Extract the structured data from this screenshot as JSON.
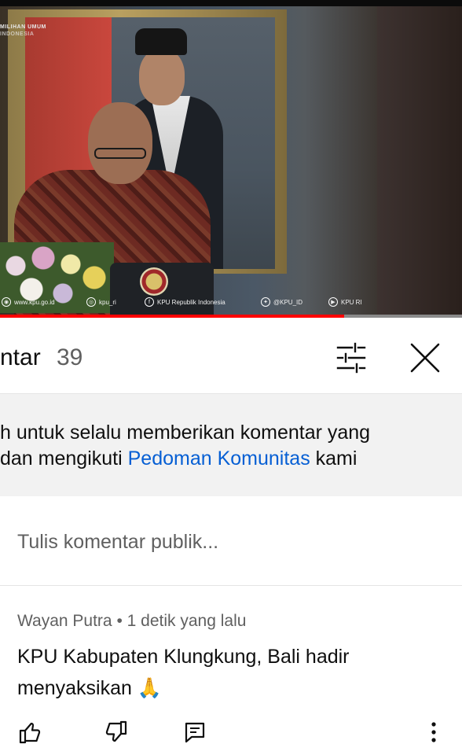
{
  "video": {
    "watermark_line1": "MILIHAN UMUM",
    "watermark_line2": "INDONESIA",
    "ticker": [
      {
        "icon": "globe-icon",
        "glyph": "◉",
        "text": "www.kpu.go.id"
      },
      {
        "icon": "instagram-icon",
        "glyph": "◎",
        "text": "kpu_ri"
      },
      {
        "icon": "facebook-icon",
        "glyph": "f",
        "text": "KPU Republik Indonesia"
      },
      {
        "icon": "twitter-icon",
        "glyph": "✦",
        "text": "@KPU_ID"
      },
      {
        "icon": "youtube-icon",
        "glyph": "▶",
        "text": "KPU RI"
      }
    ],
    "progress_fraction": 0.745,
    "colors": {
      "progress": "#ff0000",
      "progress_track": "#8a8a8a"
    }
  },
  "comments_header": {
    "title": "ntar",
    "count": "39"
  },
  "guidelines": {
    "line1": "h untuk selalu memberikan komentar yang",
    "line2_prefix": "dan mengikuti ",
    "line2_link": "Pedoman Komunitas",
    "line2_suffix": " kami",
    "link_color": "#065fd4"
  },
  "compose": {
    "placeholder": "Tulis komentar publik..."
  },
  "comment": {
    "author": "Wayan Putra",
    "separator": " • ",
    "time": "1 detik yang lalu",
    "text": "KPU Kabupaten Klungkung, Bali hadir menyaksikan 🙏"
  }
}
